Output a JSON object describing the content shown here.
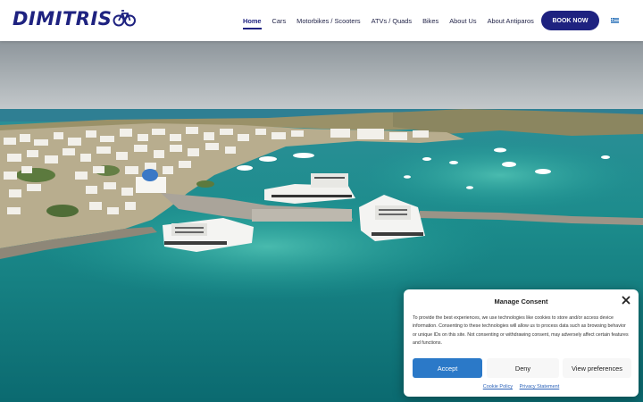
{
  "brand": {
    "logo_text": "DIMITRIS",
    "logo_color": "#1e2280"
  },
  "nav": {
    "items": [
      "Home",
      "Cars",
      "Motorbikes / Scooters",
      "ATVs / Quads",
      "Bikes",
      "About Us",
      "About Antiparos"
    ],
    "active": "Home",
    "book_label": "BOOK NOW",
    "language_flag": "greek-flag-icon"
  },
  "hero": {
    "scene": "aerial-harbor-photo"
  },
  "consent": {
    "title": "Manage Consent",
    "body": "To provide the best experiences, we use technologies like cookies to store and/or access device information. Consenting to these technologies will allow us to process data such as browsing behavior or unique IDs on this site. Not consenting or withdrawing consent, may adversely affect certain features and functions.",
    "accept_label": "Accept",
    "deny_label": "Deny",
    "prefs_label": "View preferences",
    "cookie_policy_label": "Cookie Policy",
    "privacy_label": "Privacy Statement",
    "accent_color": "#2b79c8"
  }
}
